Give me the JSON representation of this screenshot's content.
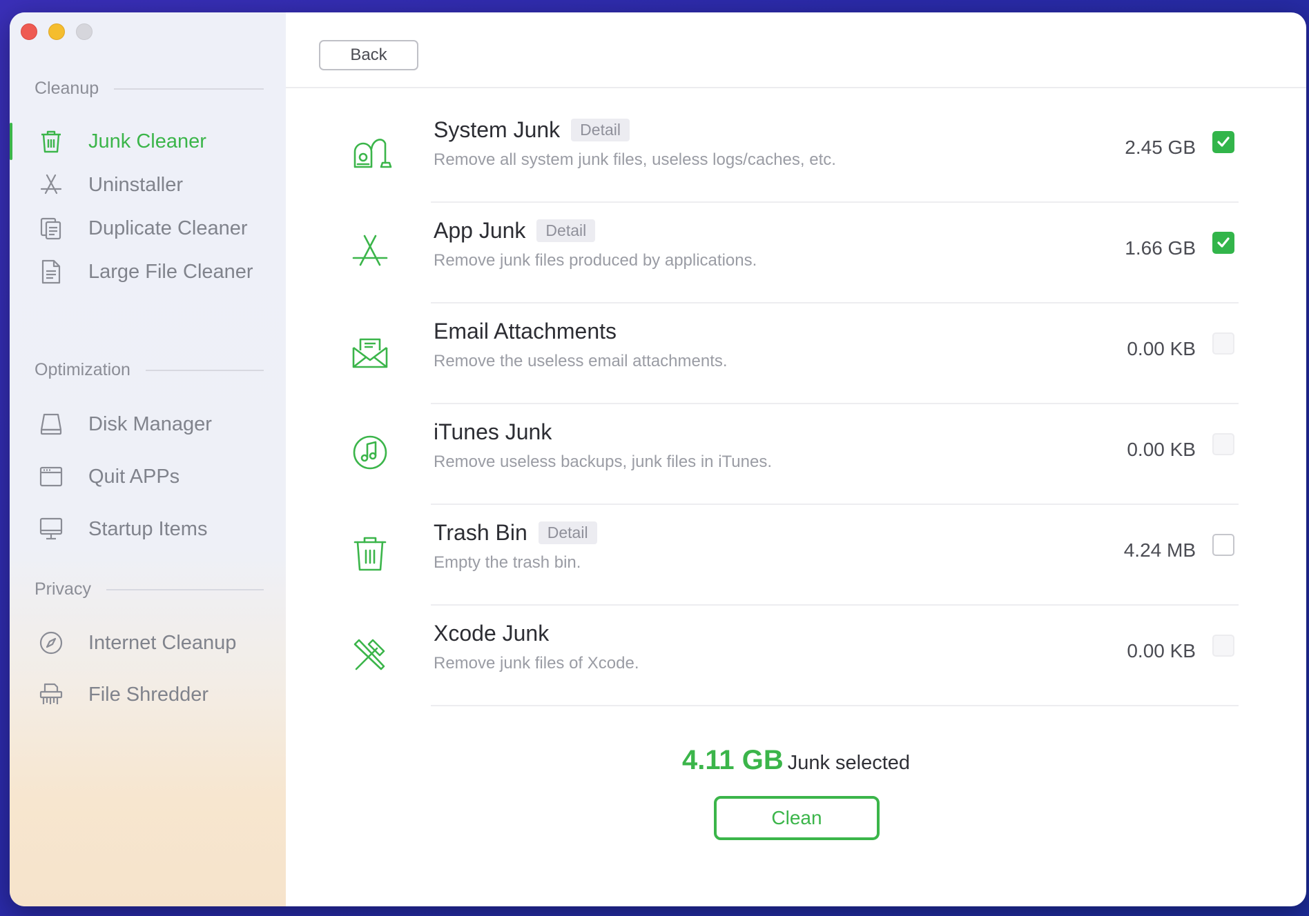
{
  "sidebar": {
    "sections": [
      {
        "title": "Cleanup"
      },
      {
        "title": "Optimization"
      },
      {
        "title": "Privacy"
      }
    ],
    "items": [
      {
        "label": "Junk Cleaner",
        "icon": "trash-icon"
      },
      {
        "label": "Uninstaller",
        "icon": "app-store-icon"
      },
      {
        "label": "Duplicate Cleaner",
        "icon": "duplicate-icon"
      },
      {
        "label": "Large File Cleaner",
        "icon": "document-icon"
      },
      {
        "label": "Disk Manager",
        "icon": "disk-icon"
      },
      {
        "label": "Quit APPs",
        "icon": "window-icon"
      },
      {
        "label": "Startup Items",
        "icon": "monitor-icon"
      },
      {
        "label": "Internet Cleanup",
        "icon": "compass-icon"
      },
      {
        "label": "File Shredder",
        "icon": "shredder-icon"
      }
    ]
  },
  "toolbar": {
    "back_label": "Back"
  },
  "rows": [
    {
      "title": "System Junk",
      "detail": "Detail",
      "desc": "Remove all system junk files, useless logs/caches, etc.",
      "size": "2.45 GB",
      "checked": true,
      "icon": "vacuum-icon"
    },
    {
      "title": "App Junk",
      "detail": "Detail",
      "desc": "Remove junk files produced by applications.",
      "size": "1.66 GB",
      "checked": true,
      "icon": "app-store-icon"
    },
    {
      "title": "Email Attachments",
      "detail": "",
      "desc": "Remove the useless email attachments.",
      "size": "0.00 KB",
      "checked": false,
      "icon": "mail-icon"
    },
    {
      "title": "iTunes Junk",
      "detail": "",
      "desc": "Remove useless backups, junk files in iTunes.",
      "size": "0.00 KB",
      "checked": false,
      "icon": "music-icon"
    },
    {
      "title": "Trash Bin",
      "detail": "Detail",
      "desc": "Empty the trash bin.",
      "size": "4.24 MB",
      "checked": false,
      "icon": "trash-icon"
    },
    {
      "title": "Xcode Junk",
      "detail": "",
      "desc": "Remove junk files of Xcode.",
      "size": "0.00 KB",
      "checked": false,
      "icon": "tools-icon"
    }
  ],
  "summary": {
    "amount": "4.11 GB",
    "label": "Junk selected"
  },
  "actions": {
    "clean_label": "Clean"
  },
  "colors": {
    "accent": "#3bb54a",
    "muted": "#80838c"
  }
}
